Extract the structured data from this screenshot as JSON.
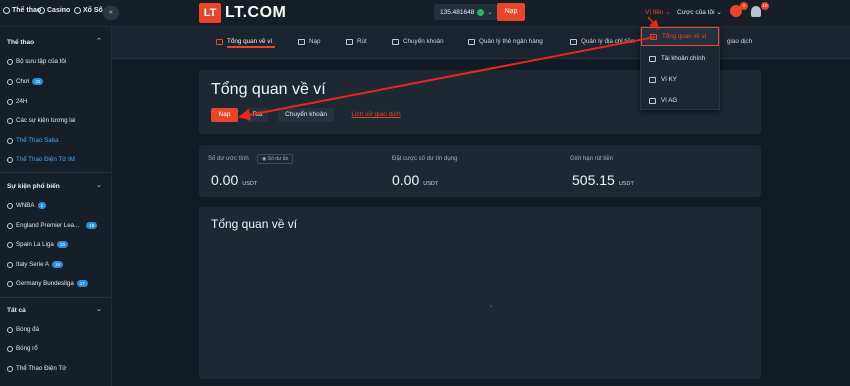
{
  "topbar": {
    "sports_label": "Thể thao",
    "casino_label": "Casino",
    "lottery_label": "Xổ Số",
    "collapse_icon": "double-chevron-left-icon",
    "logo_mark": "LT",
    "logo_text": "LT.COM",
    "balance": "135.481648",
    "deposit_label": "Nạp",
    "wallet_menu_label": "Ví tiền ⌄",
    "bets_menu_label": "Cược của tôi ⌄",
    "gift_badge": "0",
    "notify_badge": "10"
  },
  "sidebar": {
    "section1_title": "Thể thao",
    "items1": [
      {
        "label": "Bộ sưu tập của tôi",
        "icon": "star-icon"
      },
      {
        "label": "Chơi",
        "icon": "play-icon",
        "count": "32"
      },
      {
        "label": "24H",
        "icon": "clock-icon"
      },
      {
        "label": "Các sự kiện tương lai",
        "icon": "calendar-icon"
      },
      {
        "label": "Thể Thao Saba",
        "icon": "saba-icon",
        "active": true
      },
      {
        "label": "Thể Thao Điện Tử IM",
        "icon": "esports-icon",
        "active": true
      }
    ],
    "section2_title": "Sự kiện phổ biến",
    "items2": [
      {
        "label": "WNBA",
        "count": "1"
      },
      {
        "label": "England Premier Lea...",
        "count": "18"
      },
      {
        "label": "Spain La Liga",
        "count": "19"
      },
      {
        "label": "Italy Serie A",
        "count": "19"
      },
      {
        "label": "Germany Bundesliga",
        "count": "17"
      }
    ],
    "section3_title": "Tất cả",
    "items3": [
      {
        "label": "Bóng đá"
      },
      {
        "label": "Bóng rổ"
      },
      {
        "label": "Thể Thao Điện Tử"
      }
    ]
  },
  "subnav": {
    "tabs": [
      {
        "label": "Tổng quan về ví",
        "active": true
      },
      {
        "label": "Nạp"
      },
      {
        "label": "Rút"
      },
      {
        "label": "Chuyển khoản"
      },
      {
        "label": "Quản lý thẻ ngân hàng"
      },
      {
        "label": "Quản lý địa chỉ tiền"
      },
      {
        "label": "giao dịch"
      }
    ]
  },
  "dropdown": {
    "items": [
      {
        "label": "Tổng quan về ví",
        "active": true
      },
      {
        "label": "Tài khoản chính"
      },
      {
        "label": "Ví KY"
      },
      {
        "label": "Ví AG"
      }
    ]
  },
  "main": {
    "title": "Tổng quan về ví",
    "buttons": {
      "deposit": "Nạp",
      "withdraw": "Rút",
      "transfer": "Chuyển khoản",
      "history": "Lịch sử giao dịch"
    },
    "stats": [
      {
        "label": "Số dư ước tính",
        "value": "0.00",
        "unit": "USDT"
      },
      {
        "label": "Đặt cược số dư tín dụng",
        "value": "0.00",
        "unit": "USDT"
      },
      {
        "label": "Giới hạn rút tiền",
        "value": "505.15",
        "unit": "USDT"
      }
    ],
    "hide_balance_label": "Số dư ẩn",
    "overview_title": "Tổng quan về ví"
  },
  "colors": {
    "accent": "#e8462b",
    "background": "#121b23",
    "card": "#1d2832",
    "link_active": "#3fa9f5"
  }
}
